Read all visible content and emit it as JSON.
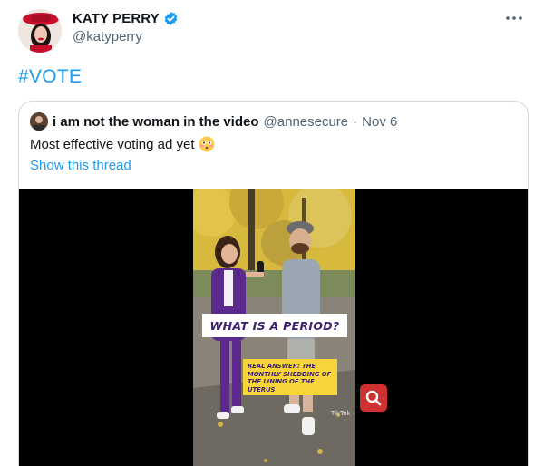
{
  "author": {
    "display_name": "KATY PERRY",
    "handle": "@katyperry",
    "verified_icon": "verified-badge-icon",
    "avatar_icon": "profile-avatar"
  },
  "tweet": {
    "text": "#VOTE"
  },
  "quoted": {
    "name": "i am not the woman in the video",
    "handle": "@annesecure",
    "separator": "·",
    "date": "Nov 6",
    "text": "Most effective voting ad yet",
    "emoji": "flushed-face-emoji",
    "show_thread": "Show this thread"
  },
  "video": {
    "overlay_question": "WHAT IS A PERIOD?",
    "overlay_answer": "REAL ANSWER: THE MONTHLY SHEDDING OF THE LINING OF THE UTERUS",
    "watermark": "TikTok",
    "zoom_icon": "search-zoom-icon"
  },
  "colors": {
    "accent": "#1d9bf0",
    "overlay_purple": "#3b1f6e",
    "overlay_yellow": "#f6d43a",
    "zoom_red": "#cf3030"
  }
}
